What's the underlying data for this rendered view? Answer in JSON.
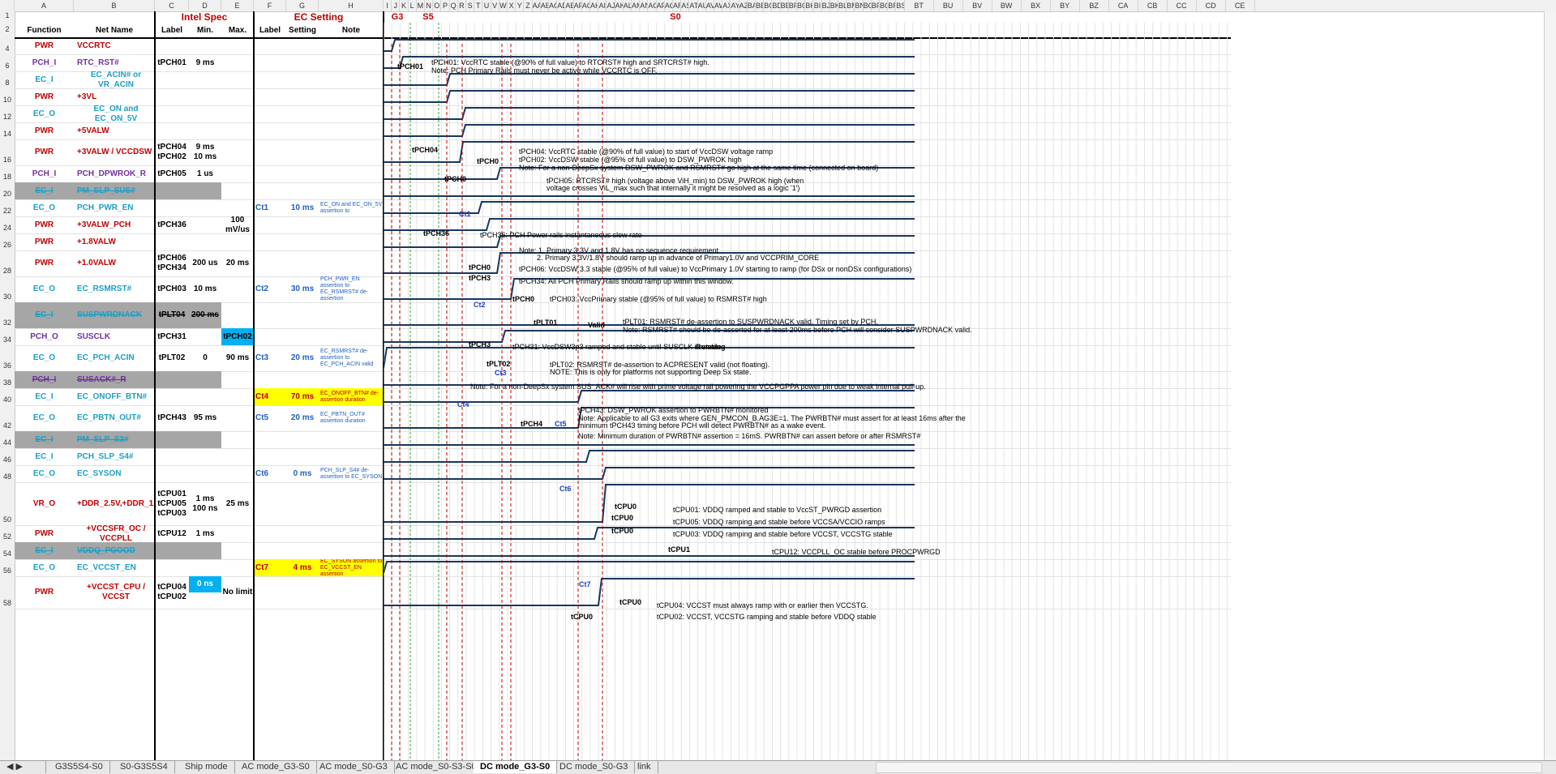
{
  "column_letters": [
    "A",
    "B",
    "C",
    "D",
    "E",
    "F",
    "G",
    "H",
    "I",
    "J",
    "K",
    "L",
    "M",
    "N",
    "O",
    "P",
    "Q",
    "R",
    "S",
    "T",
    "U",
    "V",
    "W",
    "X",
    "Y",
    "Z",
    "AA",
    "AB",
    "AC",
    "AD",
    "AE",
    "AF",
    "AG",
    "AH",
    "AI",
    "AJ",
    "AK",
    "AL",
    "AM",
    "AN",
    "AO",
    "AP",
    "AQ",
    "AR",
    "AS",
    "AT",
    "AU",
    "AV",
    "AW",
    "AX",
    "AY",
    "AZ",
    "BA",
    "BB",
    "BC",
    "BD",
    "BE",
    "BF",
    "BG",
    "BH",
    "BI",
    "BJ",
    "BK",
    "BL",
    "BM",
    "BN",
    "BO",
    "BP",
    "BQ",
    "BR",
    "BS",
    "BT",
    "BU",
    "BV",
    "BW",
    "BX",
    "BY",
    "BZ",
    "CA",
    "CB",
    "CC",
    "CD",
    "CE"
  ],
  "headers": {
    "intel_spec": "Intel Spec",
    "ec_setting": "EC Setting",
    "function": "Function",
    "net_name": "Net Name",
    "label": "Label",
    "min": "Min.",
    "max": "Max.",
    "ec_label": "Label",
    "setting": "Setting",
    "note": "Note",
    "g3": "G3",
    "s5": "S5",
    "s0": "S0"
  },
  "rows": [
    {
      "num": "4",
      "fn": "PWR",
      "fnc": "red",
      "name": "VCCRTC",
      "nc": "red",
      "label": "",
      "min": "",
      "max": "",
      "el": "",
      "es": "",
      "note": ""
    },
    {
      "num": "6",
      "fn": "PCH_I",
      "fnc": "purple",
      "name": "RTC_RST#",
      "nc": "purple",
      "label": "tPCH01",
      "min": "9 ms",
      "max": "",
      "el": "",
      "es": "",
      "note": ""
    },
    {
      "num": "8",
      "fn": "EC_I",
      "fnc": "cyan",
      "name": "EC_ACIN# or VR_ACIN",
      "nc": "cyan",
      "label": "",
      "min": "",
      "max": "",
      "el": "",
      "es": "",
      "note": ""
    },
    {
      "num": "10",
      "fn": "PWR",
      "fnc": "red",
      "name": "+3VL",
      "nc": "red",
      "label": "",
      "min": "",
      "max": "",
      "el": "",
      "es": "",
      "note": ""
    },
    {
      "num": "12",
      "fn": "EC_O",
      "fnc": "cyan",
      "name": "EC_ON and EC_ON_5V",
      "nc": "cyan",
      "label": "",
      "min": "",
      "max": "",
      "el": "",
      "es": "",
      "note": ""
    },
    {
      "num": "14",
      "fn": "PWR",
      "fnc": "red",
      "name": "+5VALW",
      "nc": "red",
      "label": "",
      "min": "",
      "max": "",
      "el": "",
      "es": "",
      "note": ""
    },
    {
      "num": "16",
      "fn": "PWR",
      "fnc": "red",
      "name": "+3VALW / VCCDSW",
      "nc": "red",
      "label": "tPCH04\ntPCH02",
      "min": "9 ms\n10 ms",
      "max": "",
      "el": "",
      "es": "",
      "note": ""
    },
    {
      "num": "18",
      "fn": "PCH_I",
      "fnc": "purple",
      "name": "PCH_DPWROK_R",
      "nc": "purple",
      "label": "tPCH05",
      "min": "1 us",
      "max": "",
      "el": "",
      "es": "",
      "note": ""
    },
    {
      "num": "20",
      "fn": "EC_I",
      "fnc": "cyan",
      "name": "PM_SLP_SUS#",
      "nc": "cyan",
      "gray": true,
      "strike": true,
      "label": "",
      "min": "",
      "max": "",
      "el": "",
      "es": "",
      "note": ""
    },
    {
      "num": "22",
      "fn": "EC_O",
      "fnc": "cyan",
      "name": "PCH_PWR_EN",
      "nc": "cyan",
      "label": "",
      "min": "",
      "max": "",
      "el": "Ct1",
      "es": "10 ms",
      "note": "EC_ON and EC_ON_5V assertion to"
    },
    {
      "num": "24",
      "fn": "PWR",
      "fnc": "red",
      "name": "+3VALW_PCH",
      "nc": "red",
      "label": "tPCH36",
      "min": "",
      "max": "100 mV/us",
      "el": "",
      "es": "",
      "note": ""
    },
    {
      "num": "26",
      "fn": "PWR",
      "fnc": "red",
      "name": "+1.8VALW",
      "nc": "red",
      "label": "",
      "min": "",
      "max": "",
      "el": "",
      "es": "",
      "note": ""
    },
    {
      "num": "28",
      "fn": "PWR",
      "fnc": "red",
      "name": "+1.0VALW",
      "nc": "red",
      "label": "tPCH06\ntPCH34",
      "min": "200 us",
      "max": "20 ms",
      "el": "",
      "es": "",
      "note": ""
    },
    {
      "num": "30",
      "fn": "EC_O",
      "fnc": "cyan",
      "name": "EC_RSMRST#",
      "nc": "cyan",
      "label": "tPCH03",
      "min": "10 ms",
      "max": "",
      "el": "Ct2",
      "es": "30 ms",
      "note": "PCH_PWR_EN assertion to EC_RSMRST# de-assertion"
    },
    {
      "num": "32",
      "fn": "EC_I",
      "fnc": "cyan",
      "name": "SUSPWRDNACK",
      "nc": "cyan",
      "gray": true,
      "strike": true,
      "label": "tPLT04",
      "min": "200 ms",
      "max": "",
      "el": "",
      "es": "",
      "note": ""
    },
    {
      "num": "34",
      "fn": "PCH_O",
      "fnc": "purple",
      "name": "SUSCLK",
      "nc": "purple",
      "label": "tPCH31",
      "min": "",
      "max": "tPCH02",
      "maxblue": true,
      "el": "",
      "es": "",
      "note": ""
    },
    {
      "num": "36",
      "fn": "EC_O",
      "fnc": "cyan",
      "name": "EC_PCH_ACIN",
      "nc": "cyan",
      "label": "tPLT02",
      "min": "0",
      "max": "90 ms",
      "el": "Ct3",
      "es": "20 ms",
      "note": "EC_RSMRST# de-assertion to EC_PCH_ACIN valid"
    },
    {
      "num": "38",
      "fn": "PCH_I",
      "fnc": "purple",
      "name": "SUSACK#_R",
      "nc": "purple",
      "gray": true,
      "strike": true,
      "label": "",
      "min": "",
      "max": "",
      "el": "",
      "es": "",
      "note": ""
    },
    {
      "num": "40",
      "fn": "EC_I",
      "fnc": "cyan",
      "name": "EC_ONOFF_BTN#",
      "nc": "cyan",
      "label": "",
      "min": "",
      "max": "",
      "el": "Ct4",
      "es": "70 ms",
      "yellow": true,
      "note": "EC_ONOFF_BTN# de-assertion duration"
    },
    {
      "num": "42",
      "fn": "EC_O",
      "fnc": "cyan",
      "name": "EC_PBTN_OUT#",
      "nc": "cyan",
      "label": "tPCH43",
      "min": "95 ms",
      "max": "",
      "el": "Ct5",
      "es": "20 ms",
      "note": "EC_PBTN_OUT# assertion duration"
    },
    {
      "num": "44",
      "fn": "EC_I",
      "fnc": "cyan",
      "name": "PM_SLP_S3#",
      "nc": "cyan",
      "gray": true,
      "strike": true,
      "label": "",
      "min": "",
      "max": "",
      "el": "",
      "es": "",
      "note": ""
    },
    {
      "num": "46",
      "fn": "EC_I",
      "fnc": "cyan",
      "name": "PCH_SLP_S4#",
      "nc": "cyan",
      "label": "",
      "min": "",
      "max": "",
      "el": "",
      "es": "",
      "note": ""
    },
    {
      "num": "48",
      "fn": "EC_O",
      "fnc": "cyan",
      "name": "EC_SYSON",
      "nc": "cyan",
      "label": "",
      "min": "",
      "max": "",
      "el": "Ct6",
      "es": "0 ms",
      "note": "PCH_SLP_S4# de-assertion to EC_SYSON"
    },
    {
      "num": "50",
      "fn": "VR_O",
      "fnc": "red",
      "name": "+DDR_2.5V,+DDR_1.2V",
      "nc": "red",
      "label": "tCPU01\ntCPU05\ntCPU03",
      "min": "1 ms\n100 ns",
      "max": "25 ms",
      "el": "",
      "es": "",
      "note": ""
    },
    {
      "num": "52",
      "fn": "PWR",
      "fnc": "red",
      "name": "+VCCSFR_OC / VCCPLL",
      "nc": "red",
      "label": "tCPU12",
      "min": "1 ms",
      "max": "",
      "el": "",
      "es": "",
      "note": ""
    },
    {
      "num": "54",
      "fn": "EC_I",
      "fnc": "cyan",
      "name": "VDDQ_PGOOD",
      "nc": "cyan",
      "gray": true,
      "strike": true,
      "label": "",
      "min": "",
      "max": "",
      "el": "",
      "es": "",
      "note": ""
    },
    {
      "num": "56",
      "fn": "EC_O",
      "fnc": "cyan",
      "name": "EC_VCCST_EN",
      "nc": "cyan",
      "label": "",
      "min": "",
      "max": "",
      "el": "Ct7",
      "es": "4 ms",
      "yellow": true,
      "note": "EC_SYSON assertion to EC_VCCST_EN assertion"
    },
    {
      "num": "58",
      "fn": "PWR",
      "fnc": "red",
      "name": "+VCCST_CPU / VCCST",
      "nc": "red",
      "label": "tCPU04\ntCPU02",
      "min": "0 ns",
      "minblue": true,
      "max": "No limit",
      "el": "",
      "es": "",
      "note": ""
    }
  ],
  "annotations": [
    "tPCH01: VccRTC stable (@90% of full value) to RTCRST# high and SRTCRST# high.",
    "Note: PCH Primary Rails must  never be active while VCCRTC is OFF.",
    "tPCH04: VccRTC stable (@90% of full value) to start of VccDSW voltage ramp",
    "tPCH02: VccDSW stable (@95% of full value) to DSW_PWROK high",
    "Note: For a non-DeepSx system DSW_PWROK and RSMRST# go high at the same time (connected on board)",
    "tPCH05: RTCRST# high (voltage above ViH_min) to DSW_PWROK high (when",
    "voltage crosses ViL_max such that internally it might be resolved as a logic '1')",
    "tPCH36: PCH Power rails instantaneous slew rate",
    "Note: 1. Primary 3.3V and 1.8V has no sequence requirement",
    "2. Primary 3.3V/1.8V should ramp up in advance of Primary1.0V and VCCPRIM_CORE",
    "tPCH06: VccDSW 3.3 stable (@95% of full value) to VccPrimary 1.0V starting to ramp (for DSx or nonDSx configurations)",
    "tPCH34: All PCH Primary Rails should ramp up within this window.",
    "tPCH03: VccPrimary stable (@95% of full value) to RSMRST# high",
    "tPLT01: RSMRST# de-assertion to SUSPWRDNACK  valid. Timing set by PCH.",
    "Note: RSMRST# should be de-asserted for at least 200ms before PCH will consider SUSPWRDNACK valid.",
    "tPCH31: VccDSW3p3 ramped and stable until SUSCLK is stable",
    "tPLT02: RSMRST# de-assertion to ACPRESENT valid (not floating).",
    "NOTE:  This is only for platforms not supporting Deep Sx state.",
    "Note: For a non-DeepSx system  SUS_ACK# will rise with prime voltage rail powering the VCCPGPPA power pin due to weak internal pull-up.",
    "tPCH43: DSW_PWROK assertion to PWRBTN# monitored",
    "Note: Applicable to all G3 exits where GEN_PMCON_B.AG3E=1. The PWRBTN# must assert  for at least 16ms after the",
    "minimum tPCH43 timing before PCH will detect PWRBTN# as a wake event.",
    "Note: Minimum duration of PWRBTN# assertion = 16mS. PWRBTN# can assert  before or after RSMRST#",
    "tCPU01: VDDQ ramped and stable to VccST_PWRGD assertion",
    "tCPU05: VDDQ ramping and stable before VCCSA/VCCIO ramps",
    "tCPU03: VDDQ ramping and stable before VCCST, VCCSTG stable",
    "tCPU12: VCCPLL_OC stable before PROCPWRGD",
    "tCPU04: VCCST must always ramp with or earlier then VCCSTG.",
    "tCPU02: VCCST, VCCSTG ramping and stable before VDDQ stable"
  ],
  "timing_labels": {
    "tpch01": "tPCH01",
    "tpch04": "tPCH04",
    "tpch0a": "tPCH0",
    "tpch0b": "tPCH0",
    "ct1": "Ct1",
    "tpch36": "tPCH36",
    "tpch0c": "tPCH0",
    "tpch3a": "tPCH3",
    "ct2": "Ct2",
    "tpch0d": "tPCH0",
    "tplt01": "tPLT01",
    "valid": "Valid",
    "tpch3b": "tPCH3",
    "running": "Running",
    "tplt02": "tPLT02",
    "ct3": "Ct3",
    "ct4": "Ct4",
    "tpch4": "tPCH4",
    "ct5": "Ct5",
    "ct6": "Ct6",
    "tcpu0a": "tCPU0",
    "tcpu0b": "tCPU0",
    "tcpu0c": "tCPU0",
    "tcpu1": "tCPU1",
    "ct7": "Ct7",
    "tcpu0d": "tCPU0",
    "tcpu0e": "tCPU0"
  },
  "sheet_tabs": [
    "G3S5S4-S0",
    "S0-G3S5S4",
    "Ship mode",
    "AC mode_G3-S0",
    "AC mode_S0-G3",
    "AC mode_S0-S3-S0",
    "DC mode_G3-S0",
    "DC mode_S0-G3",
    "link"
  ],
  "active_tab": "DC mode_G3-S0",
  "colors": {
    "wave": "#17375e",
    "red": "#c00000",
    "blue": "#1f5fbf"
  }
}
